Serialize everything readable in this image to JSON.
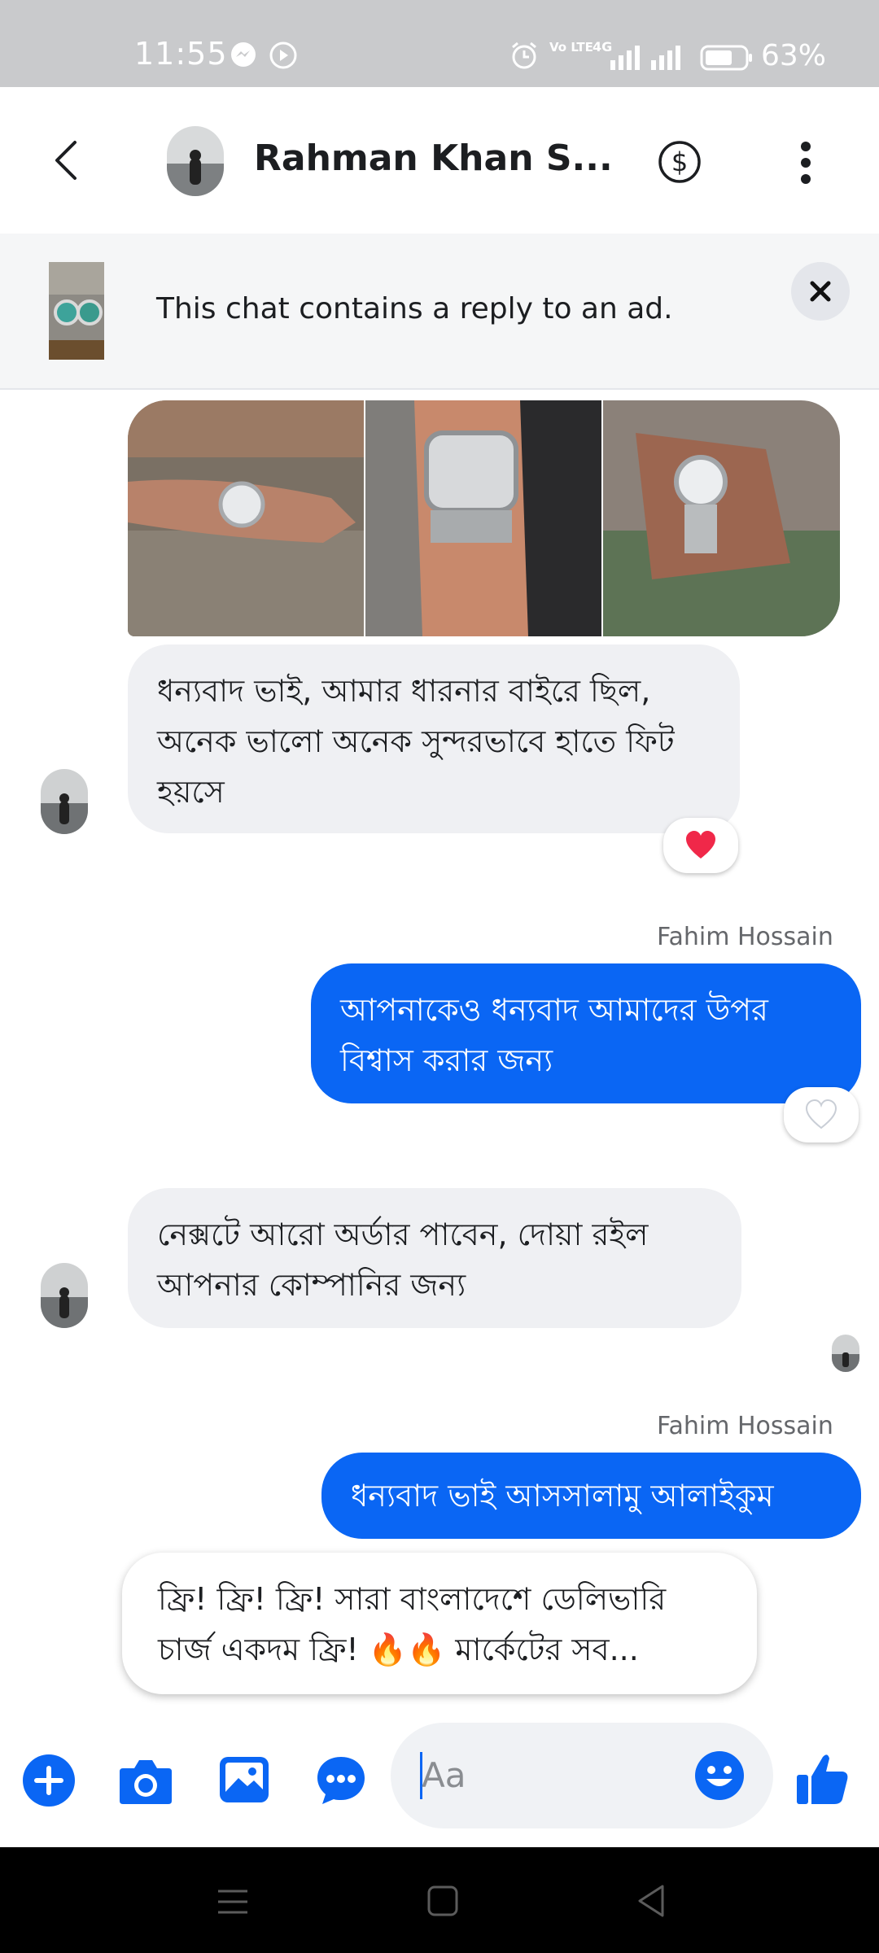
{
  "status_bar": {
    "time": "11:55",
    "battery": "63%",
    "network": "4G",
    "volte": "Vo LTE"
  },
  "header": {
    "contact_name": "Rahman Khan S...",
    "back_icon": "chevron-left-icon",
    "payment_icon": "dollar-circle-icon",
    "menu_icon": "more-vertical-icon"
  },
  "ad_banner": {
    "text": "This chat contains a reply to an ad."
  },
  "messages": [
    {
      "type": "photos",
      "from": "contact",
      "count": 3
    },
    {
      "type": "text",
      "from": "contact",
      "text": "ধন্যবাদ ভাই, আমার ধারনার বাইরে ছিল, অনেক ভালো অনেক সুন্দরভাবে হাতে ফিট হয়সে",
      "reaction": "heart"
    },
    {
      "type": "text",
      "from": "me",
      "sender": "Fahim Hossain",
      "text": "আপনাকেও ধন্যবাদ আমাদের উপর বিশ্বাস করার জন্য",
      "reaction": "heart-outline"
    },
    {
      "type": "text",
      "from": "contact",
      "text": "নেক্সটে আরো অর্ডার পাবেন,  দোয়া রইল আপনার কোম্পানির জন্য"
    },
    {
      "type": "text",
      "from": "me",
      "sender": "Fahim Hossain",
      "text": "ধন্যবাদ ভাই আসসালামু আলাইকুম"
    }
  ],
  "promo": {
    "text": "ফ্রি! ফ্রি! ফ্রি! সারা বাংলাদেশে ডেলিভারি চার্জ একদম ফ্রি! 🔥🔥 মার্কেটের সব..."
  },
  "composer": {
    "placeholder": "Aa",
    "accent": "#0a66f4"
  },
  "colors": {
    "brand_blue": "#0a66f4",
    "incoming_bubble": "#eff0f3",
    "status_bar": "#c9cacc"
  }
}
